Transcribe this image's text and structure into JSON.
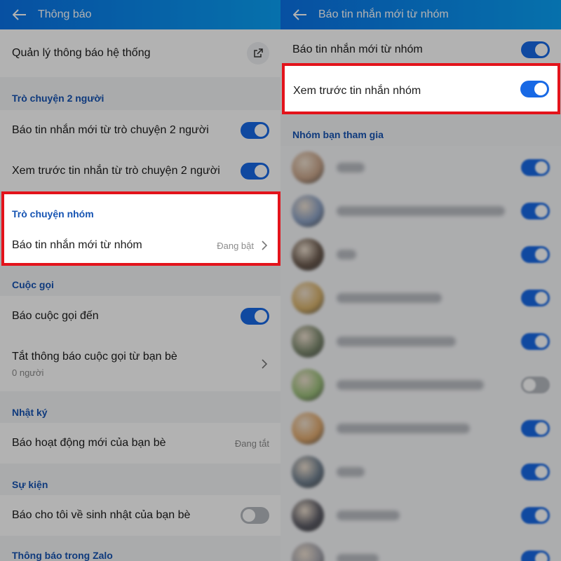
{
  "left": {
    "header_title": "Thông báo",
    "system": {
      "label": "Quản lý thông báo hệ thống",
      "icon": "external-link-icon"
    },
    "sections": {
      "direct": "Trò chuyện 2 người",
      "group": "Trò chuyện nhóm",
      "calls": "Cuộc gọi",
      "diary": "Nhật ký",
      "events": "Sự kiện",
      "zalo": "Thông báo trong Zalo"
    },
    "rows": {
      "direct_new": {
        "label": "Báo tin nhắn mới từ trò chuyện 2 người",
        "on": true
      },
      "direct_preview": {
        "label": "Xem trước tin nhắn từ trò chuyện 2 người",
        "on": true
      },
      "group_new": {
        "label": "Báo tin nhắn mới từ nhóm",
        "status": "Đang bật"
      },
      "incoming_call": {
        "label": "Báo cuộc gọi đến",
        "on": true
      },
      "mute_calls": {
        "label": "Tắt thông báo cuộc gọi từ bạn bè",
        "sub": "0 người"
      },
      "friend_activity": {
        "label": "Báo hoạt động mới của bạn bè",
        "status": "Đang tắt"
      },
      "birthday": {
        "label": "Báo cho tôi về sinh nhật của bạn bè",
        "on": false
      }
    }
  },
  "right": {
    "header_title": "Báo tin nhắn mới từ nhóm",
    "rows": {
      "group_new": {
        "label": "Báo tin nhắn mới từ nhóm",
        "on": true
      },
      "group_preview": {
        "label": "Xem trước tin nhắn nhóm",
        "on": true
      }
    },
    "section_groups": "Nhóm bạn tham gia",
    "groups": [
      {
        "on": true
      },
      {
        "on": true
      },
      {
        "on": true
      },
      {
        "on": true
      },
      {
        "on": true
      },
      {
        "on": false
      },
      {
        "on": true
      },
      {
        "on": true
      },
      {
        "on": true
      },
      {
        "on": true
      }
    ]
  },
  "colors": {
    "header": "#0b73e8",
    "toggle_on": "#1869e5",
    "toggle_off": "#b5b9bf",
    "section_text": "#1654b3",
    "highlight_border": "#e3131b"
  }
}
